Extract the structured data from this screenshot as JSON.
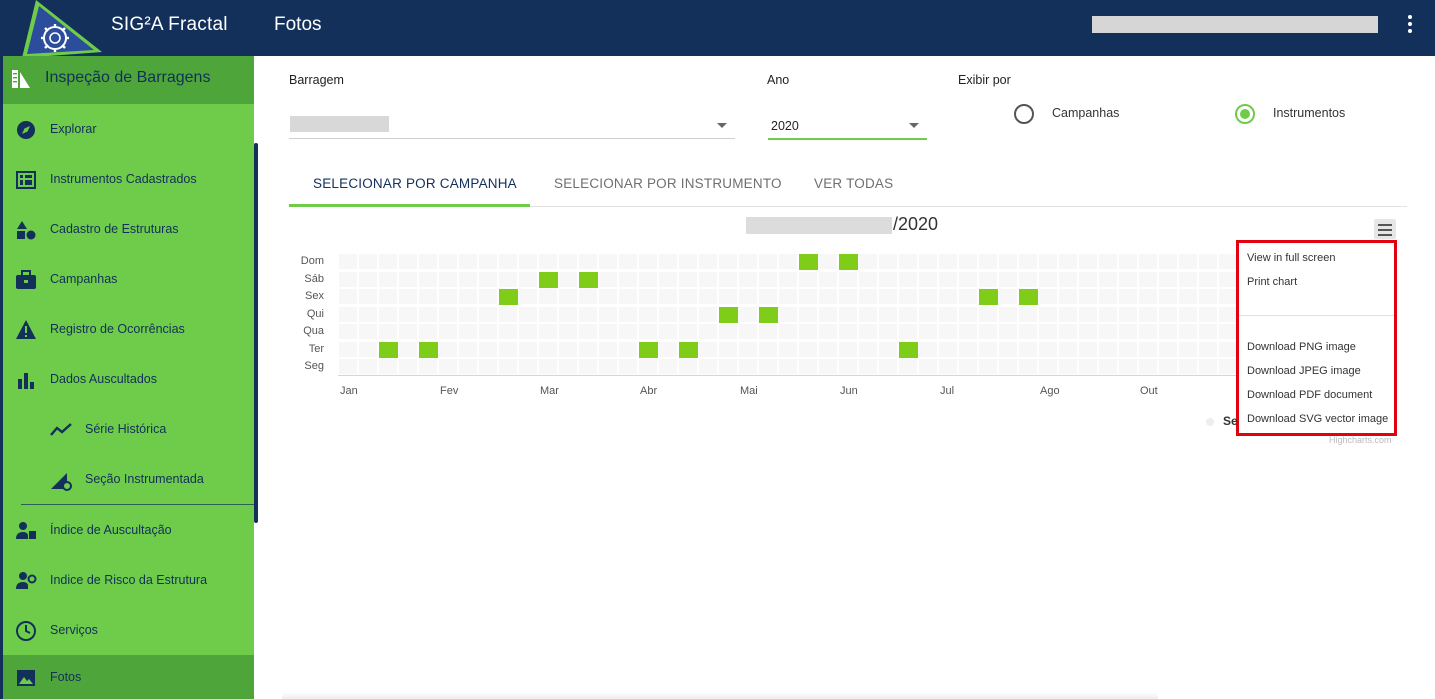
{
  "app": {
    "name": "SIG²A Fractal",
    "page_title": "Fotos"
  },
  "sidebar": {
    "header": "Inspeção de Barragens",
    "items": [
      {
        "label": "Explorar",
        "icon": "compass-icon"
      },
      {
        "label": "Instrumentos Cadastrados",
        "icon": "instrument-board-icon"
      },
      {
        "label": "Cadastro de Estruturas",
        "icon": "shapes-icon"
      },
      {
        "label": "Campanhas",
        "icon": "briefcase-icon"
      },
      {
        "label": "Registro de Ocorrências",
        "icon": "warning-icon"
      },
      {
        "label": "Dados Auscultados",
        "icon": "bar-chart-icon"
      },
      {
        "label": "Série Histórica",
        "icon": "trend-line-icon"
      },
      {
        "label": "Seção Instrumentada",
        "icon": "section-gear-icon"
      },
      {
        "label": "Índice de Auscultação",
        "icon": "worker-list-icon"
      },
      {
        "label": "Indice de Risco da Estrutura",
        "icon": "worker-gear-icon"
      },
      {
        "label": "Serviços",
        "icon": "clock-icon"
      },
      {
        "label": "Fotos",
        "icon": "image-icon"
      }
    ]
  },
  "filters": {
    "barragem_label": "Barragem",
    "ano_label": "Ano",
    "ano_value": "2020",
    "exibir_label": "Exibir por",
    "options": [
      "Campanhas",
      "Instrumentos"
    ],
    "selected": "Instrumentos"
  },
  "tabs": [
    "SELECIONAR POR CAMPANHA",
    "SELECIONAR POR INSTRUMENTO",
    "VER TODAS"
  ],
  "active_tab": 0,
  "export_menu": {
    "items": [
      "View in full screen",
      "Print chart",
      "Download PNG image",
      "Download JPEG image",
      "Download PDF document",
      "Download SVG vector image"
    ],
    "highlight_color": "#e3000f"
  },
  "legend_peek": "Se",
  "credits": "Highcharts.com",
  "colors": {
    "topbar": "#12305a",
    "sidebar": "#6fcc4a",
    "sidebar_active": "#4ea63a",
    "mark": "#7fcc19"
  },
  "chart_data": {
    "type": "heatmap",
    "title_suffix": "/2020",
    "y_categories": [
      "Seg",
      "Ter",
      "Qua",
      "Qui",
      "Sex",
      "Sáb",
      "Dom"
    ],
    "x_labels": [
      "Jan",
      "Fev",
      "Mar",
      "Abr",
      "Mai",
      "Jun",
      "Jul",
      "Ago",
      "Out"
    ],
    "x_week_of_label": [
      0,
      5,
      10,
      15,
      20,
      25,
      30,
      35,
      40
    ],
    "points": [
      {
        "week": 2,
        "day": "Ter"
      },
      {
        "week": 4,
        "day": "Ter"
      },
      {
        "week": 8,
        "day": "Sex"
      },
      {
        "week": 10,
        "day": "Sáb"
      },
      {
        "week": 12,
        "day": "Sáb"
      },
      {
        "week": 15,
        "day": "Ter"
      },
      {
        "week": 17,
        "day": "Ter"
      },
      {
        "week": 19,
        "day": "Qui"
      },
      {
        "week": 21,
        "day": "Qui"
      },
      {
        "week": 23,
        "day": "Dom"
      },
      {
        "week": 25,
        "day": "Dom"
      },
      {
        "week": 28,
        "day": "Ter"
      },
      {
        "week": 32,
        "day": "Sex"
      },
      {
        "week": 34,
        "day": "Sex"
      }
    ]
  }
}
